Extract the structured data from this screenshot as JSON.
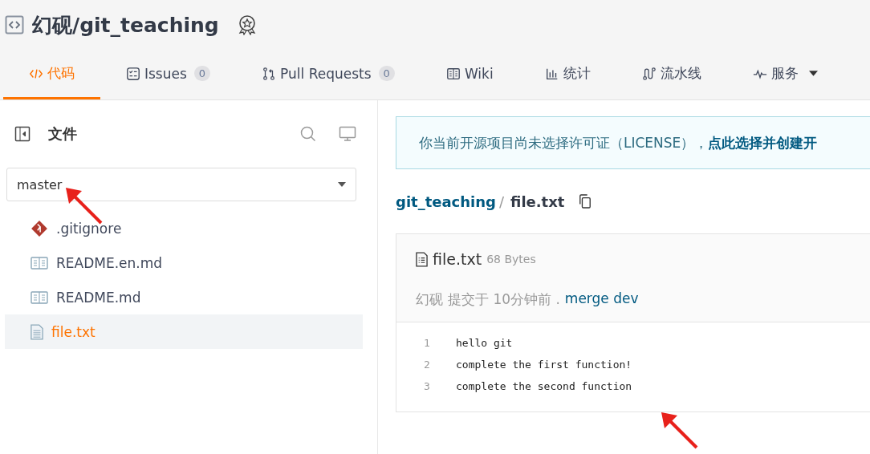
{
  "repo": {
    "title": "幻砚/git_teaching"
  },
  "tabs": [
    {
      "kind": "code",
      "label": "代码",
      "selected": true
    },
    {
      "kind": "issues",
      "label": "Issues",
      "count": "0",
      "selected": false
    },
    {
      "kind": "pr",
      "label": "Pull Requests",
      "count": "0",
      "selected": false
    },
    {
      "kind": "wiki",
      "label": "Wiki",
      "selected": false
    },
    {
      "kind": "stats",
      "label": "统计",
      "selected": false
    },
    {
      "kind": "pipeline",
      "label": "流水线",
      "selected": false
    },
    {
      "kind": "service",
      "label": "服务",
      "dropdown": true,
      "selected": false
    }
  ],
  "sidebar": {
    "title": "文件",
    "branch": "master",
    "files": [
      {
        "kind": "git",
        "name": ".gitignore",
        "selected": false
      },
      {
        "kind": "readme",
        "name": "README.en.md",
        "selected": false
      },
      {
        "kind": "readme",
        "name": "README.md",
        "selected": false
      },
      {
        "kind": "text",
        "name": "file.txt",
        "selected": true
      }
    ]
  },
  "notice": {
    "text": "你当前开源项目尚未选择许可证（LICENSE），",
    "link": "点此选择并创建开"
  },
  "breadcrumb": {
    "repo": "git_teaching",
    "separator": "/",
    "file": "file.txt"
  },
  "file": {
    "name": "file.txt",
    "size": "68 Bytes",
    "author": "幻砚",
    "committed": "提交于 10分钟前 .",
    "message": "merge dev",
    "lines": [
      {
        "number": "1",
        "code": "hello git"
      },
      {
        "number": "2",
        "code": "complete the first function!"
      },
      {
        "number": "3",
        "code": "complete the second function"
      }
    ]
  }
}
